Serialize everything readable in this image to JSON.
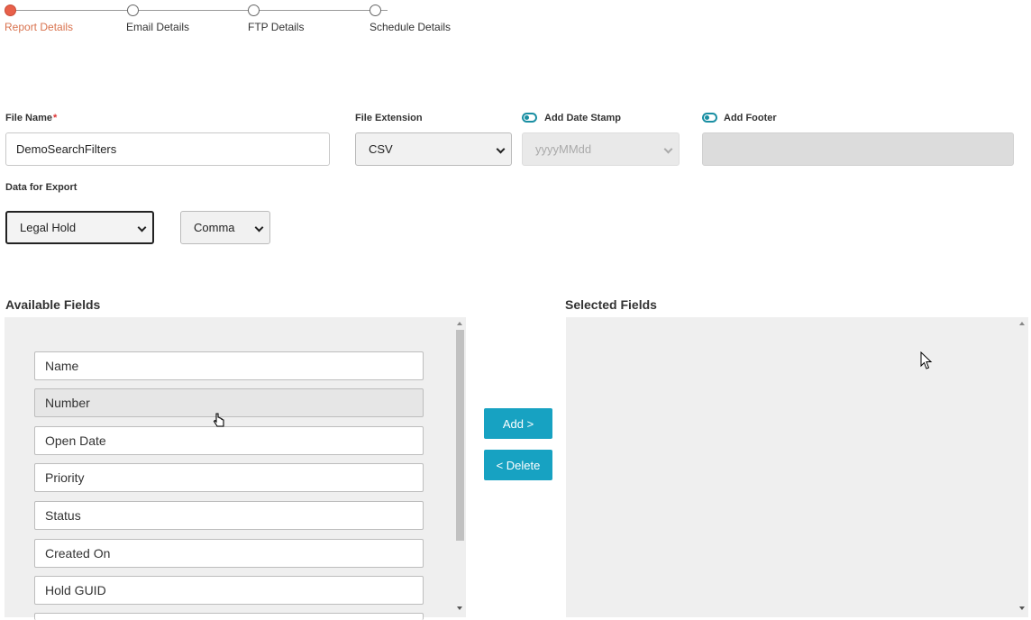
{
  "stepper": {
    "steps": [
      {
        "label": "Report Details",
        "active": true
      },
      {
        "label": "Email Details",
        "active": false
      },
      {
        "label": "FTP Details",
        "active": false
      },
      {
        "label": "Schedule Details",
        "active": false
      }
    ]
  },
  "form": {
    "file_name_label": "File Name",
    "required_mark": "*",
    "file_name_value": "DemoSearchFilters",
    "file_extension_label": "File Extension",
    "file_extension_value": "CSV",
    "date_stamp_label": "Add Date Stamp",
    "date_stamp_format": "yyyyMMdd",
    "footer_label": "Add Footer",
    "footer_value": "",
    "data_for_export_label": "Data for Export",
    "data_for_export_value": "Legal Hold",
    "delimiter_value": "Comma"
  },
  "fields": {
    "available_title": "Available Fields",
    "selected_title": "Selected Fields",
    "available": [
      "Name",
      "Number",
      "Open Date",
      "Priority",
      "Status",
      "Created On",
      "Hold GUID"
    ],
    "selected": [],
    "add_label": "Add >",
    "delete_label": "< Delete"
  },
  "colors": {
    "accent": "#17a2c2",
    "active_step": "#e8604a"
  }
}
